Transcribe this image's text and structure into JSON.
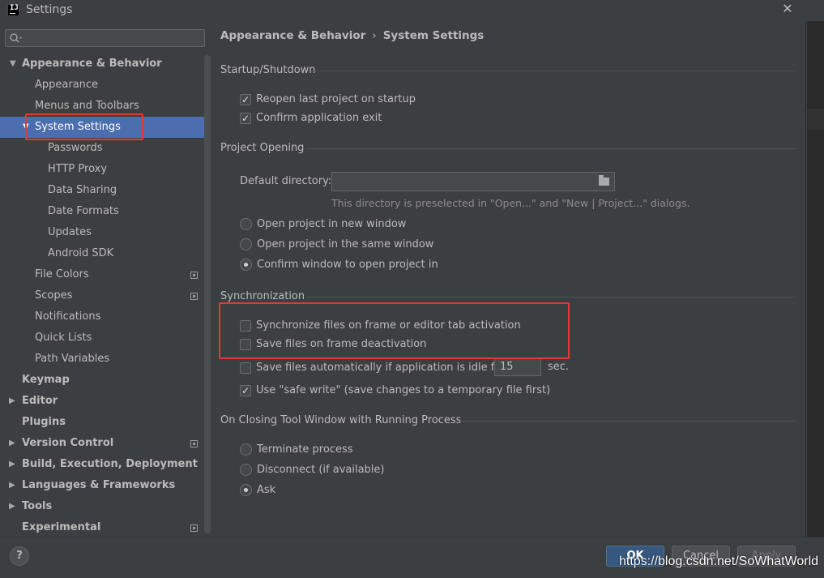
{
  "window": {
    "title": "Settings",
    "app_icon_text": "IJ",
    "close_glyph": "✕"
  },
  "sidebar": {
    "items": [
      {
        "label": "Appearance & Behavior",
        "arrow": "▼"
      },
      {
        "label": "Appearance"
      },
      {
        "label": "Menus and Toolbars"
      },
      {
        "label": "System Settings",
        "arrow": "▼"
      },
      {
        "label": "Passwords"
      },
      {
        "label": "HTTP Proxy"
      },
      {
        "label": "Data Sharing"
      },
      {
        "label": "Date Formats"
      },
      {
        "label": "Updates"
      },
      {
        "label": "Android SDK"
      },
      {
        "label": "File Colors"
      },
      {
        "label": "Scopes"
      },
      {
        "label": "Notifications"
      },
      {
        "label": "Quick Lists"
      },
      {
        "label": "Path Variables"
      },
      {
        "label": "Keymap"
      },
      {
        "label": "Editor",
        "arrow": "▶"
      },
      {
        "label": "Plugins"
      },
      {
        "label": "Version Control",
        "arrow": "▶"
      },
      {
        "label": "Build, Execution, Deployment",
        "arrow": "▶"
      },
      {
        "label": "Languages & Frameworks",
        "arrow": "▶"
      },
      {
        "label": "Tools",
        "arrow": "▶"
      },
      {
        "label": "Experimental"
      }
    ]
  },
  "breadcrumb": {
    "parent": "Appearance & Behavior",
    "separator": "›",
    "current": "System Settings"
  },
  "startup": {
    "title": "Startup/Shutdown",
    "reopen_label": "Reopen last project on startup",
    "confirm_exit_label": "Confirm application exit"
  },
  "project_opening": {
    "title": "Project Opening",
    "default_dir_label": "Default directory:",
    "default_dir_value": "",
    "hint": "This directory is preselected in \"Open...\" and \"New | Project...\" dialogs.",
    "opt_new_window": "Open project in new window",
    "opt_same_window": "Open project in the same window",
    "opt_confirm": "Confirm window to open project in"
  },
  "sync": {
    "title": "Synchronization",
    "sync_files_label": "Synchronize files on frame or editor tab activation",
    "save_deactivation_label": "Save files on frame deactivation",
    "save_idle_label": "Save files automatically if application is idle for",
    "idle_value": "15",
    "idle_unit": "sec.",
    "safe_write_label": "Use \"safe write\" (save changes to a temporary file first)"
  },
  "closing": {
    "title": "On Closing Tool Window with Running Process",
    "opt_terminate": "Terminate process",
    "opt_disconnect": "Disconnect (if available)",
    "opt_ask": "Ask"
  },
  "buttons": {
    "help": "?",
    "ok": "OK",
    "cancel": "Cancel",
    "apply": "Apply"
  },
  "watermark": "https://blog.csdn.net/SoWhatWorld",
  "colors": {
    "selection": "#4b6eaf",
    "highlight": "#e53935",
    "primary_button": "#365880"
  }
}
